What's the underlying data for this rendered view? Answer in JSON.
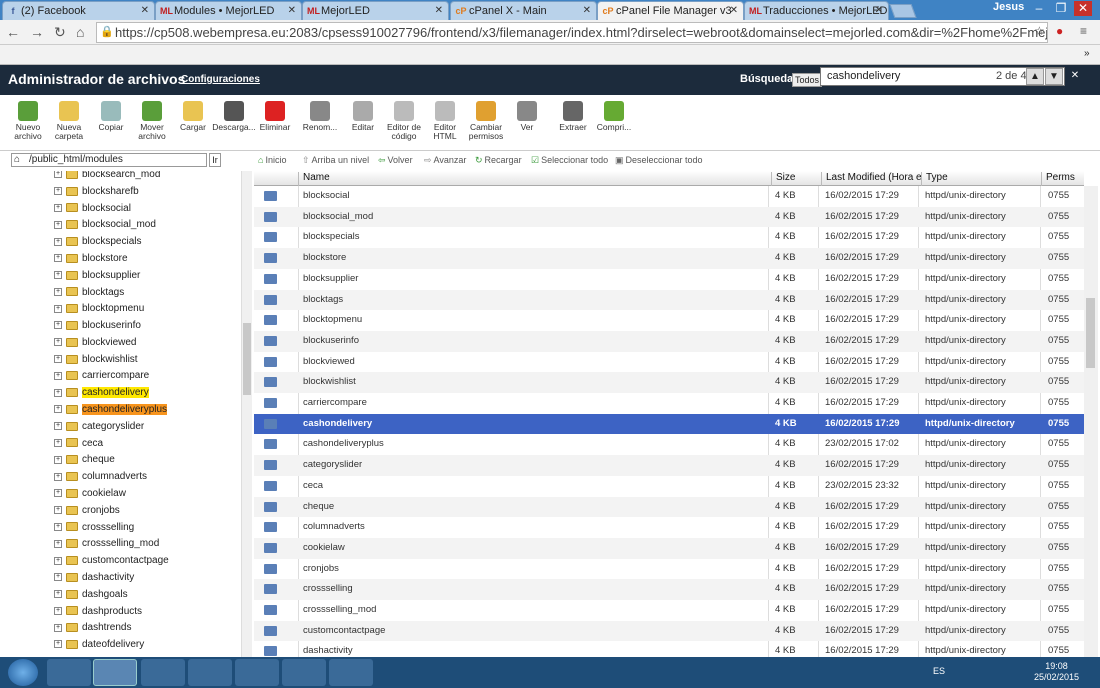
{
  "browser": {
    "tabs": [
      {
        "label": "(2) Facebook",
        "fav": "f",
        "favcolor": "#3b5998"
      },
      {
        "label": "Modules • MejorLED",
        "fav": "ML",
        "favcolor": "#c21f1f"
      },
      {
        "label": "MejorLED",
        "fav": "ML",
        "favcolor": "#c21f1f"
      },
      {
        "label": "cPanel X - Main",
        "fav": "cP",
        "favcolor": "#e07a1b"
      },
      {
        "label": "cPanel File Manager v3",
        "fav": "cP",
        "favcolor": "#e07a1b"
      },
      {
        "label": "Traducciones • MejorLED",
        "fav": "ML",
        "favcolor": "#c21f1f"
      }
    ],
    "active_tab": 4,
    "user": "Jesus",
    "url": "https://cp508.webempresa.eu:2083/cpsess910027796/frontend/x3/filemanager/index.html?dirselect=webroot&domainselect=mejorled.com&dir=%2Fhome%2Fmejorle"
  },
  "header": {
    "title": "Administrador de archivos",
    "settings_link": "Configuraciones",
    "search_label": "Búsqueda",
    "search_scope": "Todos",
    "find_text": "cashondelivery",
    "find_count": "2 de 4"
  },
  "toolbar": [
    {
      "label": "Nuevo archivo",
      "icon": "new-file-icon",
      "color": "#5a9e3a"
    },
    {
      "label": "Nueva carpeta",
      "icon": "new-folder-icon",
      "color": "#e9c452"
    },
    {
      "label": "Copiar",
      "icon": "copy-icon",
      "color": "#9bb"
    },
    {
      "label": "Mover archivo",
      "icon": "move-icon",
      "color": "#5a9e3a"
    },
    {
      "label": "Cargar",
      "icon": "upload-icon",
      "color": "#e9c452"
    },
    {
      "label": "Descarga...",
      "icon": "download-icon",
      "color": "#555"
    },
    {
      "label": "Eliminar",
      "icon": "delete-icon",
      "color": "#d22"
    },
    {
      "label": "Renom...",
      "icon": "rename-icon",
      "color": "#888"
    },
    {
      "label": "Editar",
      "icon": "edit-icon",
      "color": "#aaa"
    },
    {
      "label": "Editor de código",
      "icon": "code-editor-icon",
      "color": "#bbb"
    },
    {
      "label": "Editor HTML",
      "icon": "html-editor-icon",
      "color": "#bbb"
    },
    {
      "label": "Cambiar permisos",
      "icon": "permissions-icon",
      "color": "#e0a030"
    },
    {
      "label": "Ver",
      "icon": "view-icon",
      "color": "#888"
    },
    {
      "label": "Extraer",
      "icon": "extract-icon",
      "color": "#666"
    },
    {
      "label": "Compri...",
      "icon": "compress-icon",
      "color": "#6a3"
    }
  ],
  "path": "/public_html/modules",
  "go_label": "Ir",
  "nav": [
    "Inicio",
    "Arriba un nivel",
    "Volver",
    "Avanzar",
    "Recargar",
    "Seleccionar todo",
    "Deseleccionar todo"
  ],
  "tree": [
    {
      "name": "blocksearch_mod"
    },
    {
      "name": "blocksharefb"
    },
    {
      "name": "blocksocial"
    },
    {
      "name": "blocksocial_mod"
    },
    {
      "name": "blockspecials"
    },
    {
      "name": "blockstore"
    },
    {
      "name": "blocksupplier"
    },
    {
      "name": "blocktags"
    },
    {
      "name": "blocktopmenu"
    },
    {
      "name": "blockuserinfo"
    },
    {
      "name": "blockviewed"
    },
    {
      "name": "blockwishlist"
    },
    {
      "name": "carriercompare"
    },
    {
      "name": "cashondelivery",
      "hl": "yellow"
    },
    {
      "name": "cashondeliveryplus",
      "hl": "orange"
    },
    {
      "name": "categoryslider"
    },
    {
      "name": "ceca"
    },
    {
      "name": "cheque"
    },
    {
      "name": "columnadverts"
    },
    {
      "name": "cookielaw"
    },
    {
      "name": "cronjobs"
    },
    {
      "name": "crossselling"
    },
    {
      "name": "crossselling_mod"
    },
    {
      "name": "customcontactpage"
    },
    {
      "name": "dashactivity"
    },
    {
      "name": "dashgoals"
    },
    {
      "name": "dashproducts"
    },
    {
      "name": "dashtrends"
    },
    {
      "name": "dateofdelivery"
    }
  ],
  "columns": [
    "Name",
    "Size",
    "Last Modified (Hora está",
    "Type",
    "Perms"
  ],
  "rows": [
    [
      "blocksocial",
      "4 KB",
      "16/02/2015 17:29",
      "httpd/unix-directory",
      "0755"
    ],
    [
      "blocksocial_mod",
      "4 KB",
      "16/02/2015 17:29",
      "httpd/unix-directory",
      "0755"
    ],
    [
      "blockspecials",
      "4 KB",
      "16/02/2015 17:29",
      "httpd/unix-directory",
      "0755"
    ],
    [
      "blockstore",
      "4 KB",
      "16/02/2015 17:29",
      "httpd/unix-directory",
      "0755"
    ],
    [
      "blocksupplier",
      "4 KB",
      "16/02/2015 17:29",
      "httpd/unix-directory",
      "0755"
    ],
    [
      "blocktags",
      "4 KB",
      "16/02/2015 17:29",
      "httpd/unix-directory",
      "0755"
    ],
    [
      "blocktopmenu",
      "4 KB",
      "16/02/2015 17:29",
      "httpd/unix-directory",
      "0755"
    ],
    [
      "blockuserinfo",
      "4 KB",
      "16/02/2015 17:29",
      "httpd/unix-directory",
      "0755"
    ],
    [
      "blockviewed",
      "4 KB",
      "16/02/2015 17:29",
      "httpd/unix-directory",
      "0755"
    ],
    [
      "blockwishlist",
      "4 KB",
      "16/02/2015 17:29",
      "httpd/unix-directory",
      "0755"
    ],
    [
      "carriercompare",
      "4 KB",
      "16/02/2015 17:29",
      "httpd/unix-directory",
      "0755"
    ],
    [
      "cashondelivery",
      "4 KB",
      "16/02/2015 17:29",
      "httpd/unix-directory",
      "0755"
    ],
    [
      "cashondeliveryplus",
      "4 KB",
      "23/02/2015 17:02",
      "httpd/unix-directory",
      "0755"
    ],
    [
      "categoryslider",
      "4 KB",
      "16/02/2015 17:29",
      "httpd/unix-directory",
      "0755"
    ],
    [
      "ceca",
      "4 KB",
      "23/02/2015 23:32",
      "httpd/unix-directory",
      "0755"
    ],
    [
      "cheque",
      "4 KB",
      "16/02/2015 17:29",
      "httpd/unix-directory",
      "0755"
    ],
    [
      "columnadverts",
      "4 KB",
      "16/02/2015 17:29",
      "httpd/unix-directory",
      "0755"
    ],
    [
      "cookielaw",
      "4 KB",
      "16/02/2015 17:29",
      "httpd/unix-directory",
      "0755"
    ],
    [
      "cronjobs",
      "4 KB",
      "16/02/2015 17:29",
      "httpd/unix-directory",
      "0755"
    ],
    [
      "crossselling",
      "4 KB",
      "16/02/2015 17:29",
      "httpd/unix-directory",
      "0755"
    ],
    [
      "crossselling_mod",
      "4 KB",
      "16/02/2015 17:29",
      "httpd/unix-directory",
      "0755"
    ],
    [
      "customcontactpage",
      "4 KB",
      "16/02/2015 17:29",
      "httpd/unix-directory",
      "0755"
    ],
    [
      "dashactivity",
      "4 KB",
      "16/02/2015 17:29",
      "httpd/unix-directory",
      "0755"
    ]
  ],
  "selected_row": 11,
  "taskbar": {
    "lang": "ES",
    "time": "19:08",
    "date": "25/02/2015"
  }
}
